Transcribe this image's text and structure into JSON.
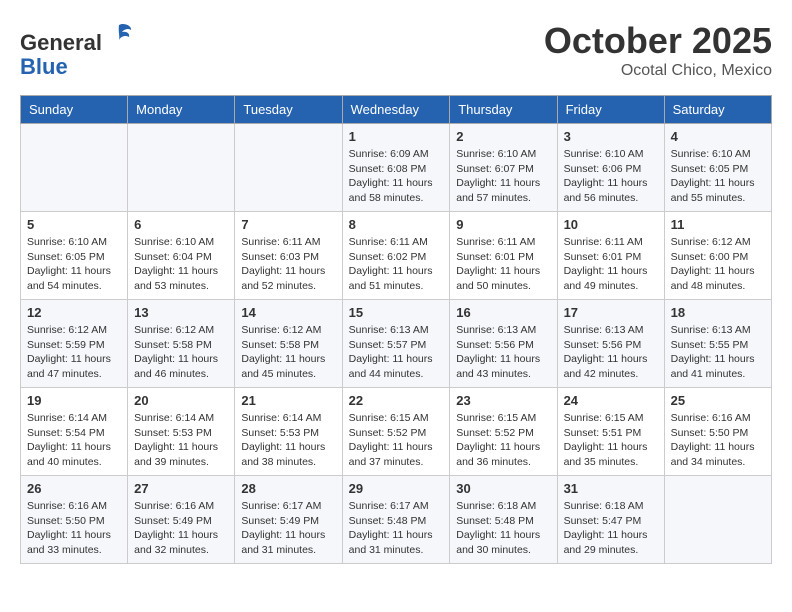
{
  "header": {
    "logo_general": "General",
    "logo_blue": "Blue",
    "month_title": "October 2025",
    "location": "Ocotal Chico, Mexico"
  },
  "days_of_week": [
    "Sunday",
    "Monday",
    "Tuesday",
    "Wednesday",
    "Thursday",
    "Friday",
    "Saturday"
  ],
  "weeks": [
    [
      {
        "day": "",
        "info": ""
      },
      {
        "day": "",
        "info": ""
      },
      {
        "day": "",
        "info": ""
      },
      {
        "day": "1",
        "info": "Sunrise: 6:09 AM\nSunset: 6:08 PM\nDaylight: 11 hours and 58 minutes."
      },
      {
        "day": "2",
        "info": "Sunrise: 6:10 AM\nSunset: 6:07 PM\nDaylight: 11 hours and 57 minutes."
      },
      {
        "day": "3",
        "info": "Sunrise: 6:10 AM\nSunset: 6:06 PM\nDaylight: 11 hours and 56 minutes."
      },
      {
        "day": "4",
        "info": "Sunrise: 6:10 AM\nSunset: 6:05 PM\nDaylight: 11 hours and 55 minutes."
      }
    ],
    [
      {
        "day": "5",
        "info": "Sunrise: 6:10 AM\nSunset: 6:05 PM\nDaylight: 11 hours and 54 minutes."
      },
      {
        "day": "6",
        "info": "Sunrise: 6:10 AM\nSunset: 6:04 PM\nDaylight: 11 hours and 53 minutes."
      },
      {
        "day": "7",
        "info": "Sunrise: 6:11 AM\nSunset: 6:03 PM\nDaylight: 11 hours and 52 minutes."
      },
      {
        "day": "8",
        "info": "Sunrise: 6:11 AM\nSunset: 6:02 PM\nDaylight: 11 hours and 51 minutes."
      },
      {
        "day": "9",
        "info": "Sunrise: 6:11 AM\nSunset: 6:01 PM\nDaylight: 11 hours and 50 minutes."
      },
      {
        "day": "10",
        "info": "Sunrise: 6:11 AM\nSunset: 6:01 PM\nDaylight: 11 hours and 49 minutes."
      },
      {
        "day": "11",
        "info": "Sunrise: 6:12 AM\nSunset: 6:00 PM\nDaylight: 11 hours and 48 minutes."
      }
    ],
    [
      {
        "day": "12",
        "info": "Sunrise: 6:12 AM\nSunset: 5:59 PM\nDaylight: 11 hours and 47 minutes."
      },
      {
        "day": "13",
        "info": "Sunrise: 6:12 AM\nSunset: 5:58 PM\nDaylight: 11 hours and 46 minutes."
      },
      {
        "day": "14",
        "info": "Sunrise: 6:12 AM\nSunset: 5:58 PM\nDaylight: 11 hours and 45 minutes."
      },
      {
        "day": "15",
        "info": "Sunrise: 6:13 AM\nSunset: 5:57 PM\nDaylight: 11 hours and 44 minutes."
      },
      {
        "day": "16",
        "info": "Sunrise: 6:13 AM\nSunset: 5:56 PM\nDaylight: 11 hours and 43 minutes."
      },
      {
        "day": "17",
        "info": "Sunrise: 6:13 AM\nSunset: 5:56 PM\nDaylight: 11 hours and 42 minutes."
      },
      {
        "day": "18",
        "info": "Sunrise: 6:13 AM\nSunset: 5:55 PM\nDaylight: 11 hours and 41 minutes."
      }
    ],
    [
      {
        "day": "19",
        "info": "Sunrise: 6:14 AM\nSunset: 5:54 PM\nDaylight: 11 hours and 40 minutes."
      },
      {
        "day": "20",
        "info": "Sunrise: 6:14 AM\nSunset: 5:53 PM\nDaylight: 11 hours and 39 minutes."
      },
      {
        "day": "21",
        "info": "Sunrise: 6:14 AM\nSunset: 5:53 PM\nDaylight: 11 hours and 38 minutes."
      },
      {
        "day": "22",
        "info": "Sunrise: 6:15 AM\nSunset: 5:52 PM\nDaylight: 11 hours and 37 minutes."
      },
      {
        "day": "23",
        "info": "Sunrise: 6:15 AM\nSunset: 5:52 PM\nDaylight: 11 hours and 36 minutes."
      },
      {
        "day": "24",
        "info": "Sunrise: 6:15 AM\nSunset: 5:51 PM\nDaylight: 11 hours and 35 minutes."
      },
      {
        "day": "25",
        "info": "Sunrise: 6:16 AM\nSunset: 5:50 PM\nDaylight: 11 hours and 34 minutes."
      }
    ],
    [
      {
        "day": "26",
        "info": "Sunrise: 6:16 AM\nSunset: 5:50 PM\nDaylight: 11 hours and 33 minutes."
      },
      {
        "day": "27",
        "info": "Sunrise: 6:16 AM\nSunset: 5:49 PM\nDaylight: 11 hours and 32 minutes."
      },
      {
        "day": "28",
        "info": "Sunrise: 6:17 AM\nSunset: 5:49 PM\nDaylight: 11 hours and 31 minutes."
      },
      {
        "day": "29",
        "info": "Sunrise: 6:17 AM\nSunset: 5:48 PM\nDaylight: 11 hours and 31 minutes."
      },
      {
        "day": "30",
        "info": "Sunrise: 6:18 AM\nSunset: 5:48 PM\nDaylight: 11 hours and 30 minutes."
      },
      {
        "day": "31",
        "info": "Sunrise: 6:18 AM\nSunset: 5:47 PM\nDaylight: 11 hours and 29 minutes."
      },
      {
        "day": "",
        "info": ""
      }
    ]
  ]
}
